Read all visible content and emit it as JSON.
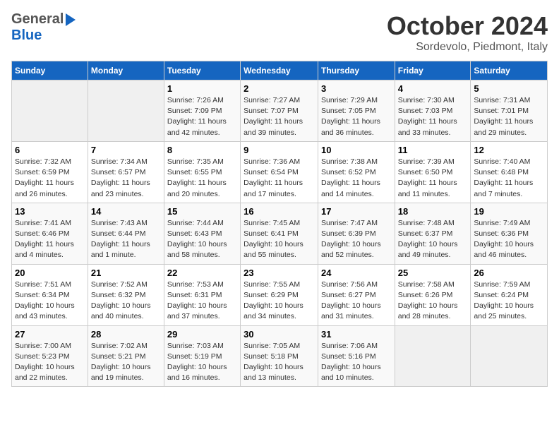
{
  "header": {
    "logo_general": "General",
    "logo_blue": "Blue",
    "month_title": "October 2024",
    "location": "Sordevolo, Piedmont, Italy"
  },
  "days_of_week": [
    "Sunday",
    "Monday",
    "Tuesday",
    "Wednesday",
    "Thursday",
    "Friday",
    "Saturday"
  ],
  "weeks": [
    [
      {
        "day": "",
        "sunrise": "",
        "sunset": "",
        "daylight": ""
      },
      {
        "day": "",
        "sunrise": "",
        "sunset": "",
        "daylight": ""
      },
      {
        "day": "1",
        "sunrise": "Sunrise: 7:26 AM",
        "sunset": "Sunset: 7:09 PM",
        "daylight": "Daylight: 11 hours and 42 minutes."
      },
      {
        "day": "2",
        "sunrise": "Sunrise: 7:27 AM",
        "sunset": "Sunset: 7:07 PM",
        "daylight": "Daylight: 11 hours and 39 minutes."
      },
      {
        "day": "3",
        "sunrise": "Sunrise: 7:29 AM",
        "sunset": "Sunset: 7:05 PM",
        "daylight": "Daylight: 11 hours and 36 minutes."
      },
      {
        "day": "4",
        "sunrise": "Sunrise: 7:30 AM",
        "sunset": "Sunset: 7:03 PM",
        "daylight": "Daylight: 11 hours and 33 minutes."
      },
      {
        "day": "5",
        "sunrise": "Sunrise: 7:31 AM",
        "sunset": "Sunset: 7:01 PM",
        "daylight": "Daylight: 11 hours and 29 minutes."
      }
    ],
    [
      {
        "day": "6",
        "sunrise": "Sunrise: 7:32 AM",
        "sunset": "Sunset: 6:59 PM",
        "daylight": "Daylight: 11 hours and 26 minutes."
      },
      {
        "day": "7",
        "sunrise": "Sunrise: 7:34 AM",
        "sunset": "Sunset: 6:57 PM",
        "daylight": "Daylight: 11 hours and 23 minutes."
      },
      {
        "day": "8",
        "sunrise": "Sunrise: 7:35 AM",
        "sunset": "Sunset: 6:55 PM",
        "daylight": "Daylight: 11 hours and 20 minutes."
      },
      {
        "day": "9",
        "sunrise": "Sunrise: 7:36 AM",
        "sunset": "Sunset: 6:54 PM",
        "daylight": "Daylight: 11 hours and 17 minutes."
      },
      {
        "day": "10",
        "sunrise": "Sunrise: 7:38 AM",
        "sunset": "Sunset: 6:52 PM",
        "daylight": "Daylight: 11 hours and 14 minutes."
      },
      {
        "day": "11",
        "sunrise": "Sunrise: 7:39 AM",
        "sunset": "Sunset: 6:50 PM",
        "daylight": "Daylight: 11 hours and 11 minutes."
      },
      {
        "day": "12",
        "sunrise": "Sunrise: 7:40 AM",
        "sunset": "Sunset: 6:48 PM",
        "daylight": "Daylight: 11 hours and 7 minutes."
      }
    ],
    [
      {
        "day": "13",
        "sunrise": "Sunrise: 7:41 AM",
        "sunset": "Sunset: 6:46 PM",
        "daylight": "Daylight: 11 hours and 4 minutes."
      },
      {
        "day": "14",
        "sunrise": "Sunrise: 7:43 AM",
        "sunset": "Sunset: 6:44 PM",
        "daylight": "Daylight: 11 hours and 1 minute."
      },
      {
        "day": "15",
        "sunrise": "Sunrise: 7:44 AM",
        "sunset": "Sunset: 6:43 PM",
        "daylight": "Daylight: 10 hours and 58 minutes."
      },
      {
        "day": "16",
        "sunrise": "Sunrise: 7:45 AM",
        "sunset": "Sunset: 6:41 PM",
        "daylight": "Daylight: 10 hours and 55 minutes."
      },
      {
        "day": "17",
        "sunrise": "Sunrise: 7:47 AM",
        "sunset": "Sunset: 6:39 PM",
        "daylight": "Daylight: 10 hours and 52 minutes."
      },
      {
        "day": "18",
        "sunrise": "Sunrise: 7:48 AM",
        "sunset": "Sunset: 6:37 PM",
        "daylight": "Daylight: 10 hours and 49 minutes."
      },
      {
        "day": "19",
        "sunrise": "Sunrise: 7:49 AM",
        "sunset": "Sunset: 6:36 PM",
        "daylight": "Daylight: 10 hours and 46 minutes."
      }
    ],
    [
      {
        "day": "20",
        "sunrise": "Sunrise: 7:51 AM",
        "sunset": "Sunset: 6:34 PM",
        "daylight": "Daylight: 10 hours and 43 minutes."
      },
      {
        "day": "21",
        "sunrise": "Sunrise: 7:52 AM",
        "sunset": "Sunset: 6:32 PM",
        "daylight": "Daylight: 10 hours and 40 minutes."
      },
      {
        "day": "22",
        "sunrise": "Sunrise: 7:53 AM",
        "sunset": "Sunset: 6:31 PM",
        "daylight": "Daylight: 10 hours and 37 minutes."
      },
      {
        "day": "23",
        "sunrise": "Sunrise: 7:55 AM",
        "sunset": "Sunset: 6:29 PM",
        "daylight": "Daylight: 10 hours and 34 minutes."
      },
      {
        "day": "24",
        "sunrise": "Sunrise: 7:56 AM",
        "sunset": "Sunset: 6:27 PM",
        "daylight": "Daylight: 10 hours and 31 minutes."
      },
      {
        "day": "25",
        "sunrise": "Sunrise: 7:58 AM",
        "sunset": "Sunset: 6:26 PM",
        "daylight": "Daylight: 10 hours and 28 minutes."
      },
      {
        "day": "26",
        "sunrise": "Sunrise: 7:59 AM",
        "sunset": "Sunset: 6:24 PM",
        "daylight": "Daylight: 10 hours and 25 minutes."
      }
    ],
    [
      {
        "day": "27",
        "sunrise": "Sunrise: 7:00 AM",
        "sunset": "Sunset: 5:23 PM",
        "daylight": "Daylight: 10 hours and 22 minutes."
      },
      {
        "day": "28",
        "sunrise": "Sunrise: 7:02 AM",
        "sunset": "Sunset: 5:21 PM",
        "daylight": "Daylight: 10 hours and 19 minutes."
      },
      {
        "day": "29",
        "sunrise": "Sunrise: 7:03 AM",
        "sunset": "Sunset: 5:19 PM",
        "daylight": "Daylight: 10 hours and 16 minutes."
      },
      {
        "day": "30",
        "sunrise": "Sunrise: 7:05 AM",
        "sunset": "Sunset: 5:18 PM",
        "daylight": "Daylight: 10 hours and 13 minutes."
      },
      {
        "day": "31",
        "sunrise": "Sunrise: 7:06 AM",
        "sunset": "Sunset: 5:16 PM",
        "daylight": "Daylight: 10 hours and 10 minutes."
      },
      {
        "day": "",
        "sunrise": "",
        "sunset": "",
        "daylight": ""
      },
      {
        "day": "",
        "sunrise": "",
        "sunset": "",
        "daylight": ""
      }
    ]
  ]
}
